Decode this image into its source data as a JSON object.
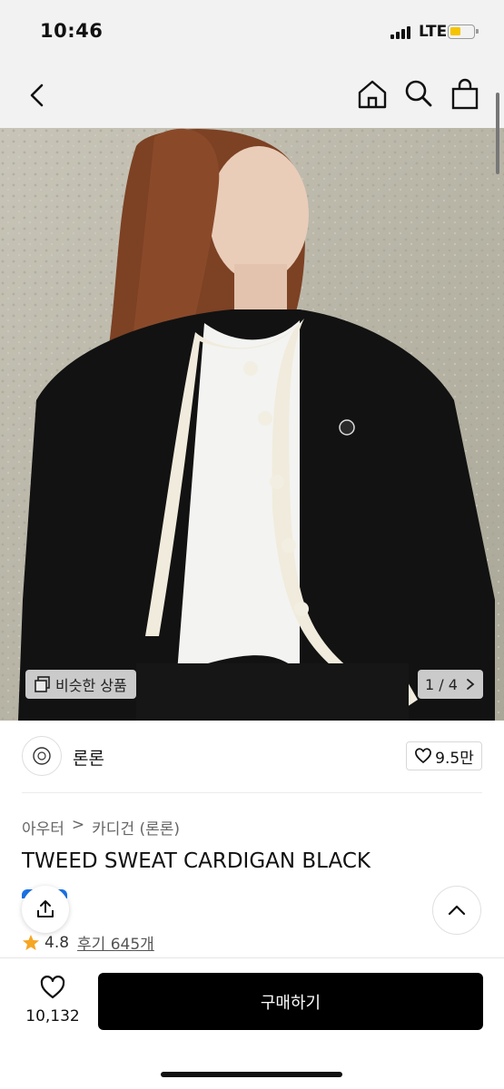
{
  "status_bar": {
    "time": "10:46",
    "network": "LTE",
    "battery_color": "#f5c400"
  },
  "nav": {
    "icons": [
      "back-chevron-icon",
      "home-icon",
      "search-icon",
      "shopping-bag-icon"
    ]
  },
  "hero": {
    "similar_label": "비슷한 상품",
    "page_indicator": "1 / 4",
    "colors": {
      "wall": "#bdbaab",
      "cardigan": "#111111",
      "trim": "#f2ede0",
      "hair": "#8a4a2a"
    }
  },
  "brand": {
    "name": "론론",
    "likes": "9.5만"
  },
  "breadcrumb": {
    "category": "아우터",
    "separator": ">",
    "subcategory": "카디건 (론론)"
  },
  "product": {
    "title": "TWEED SWEAT CARDIGAN BLACK"
  },
  "rating": {
    "score": "4.8",
    "reviews": "후기 645개",
    "star_color": "#f5a623"
  },
  "bottom": {
    "wish_count": "10,132",
    "buy_label": "구매하기"
  },
  "colors": {
    "accent": "#000000",
    "share_tab": "#1a73e8"
  }
}
